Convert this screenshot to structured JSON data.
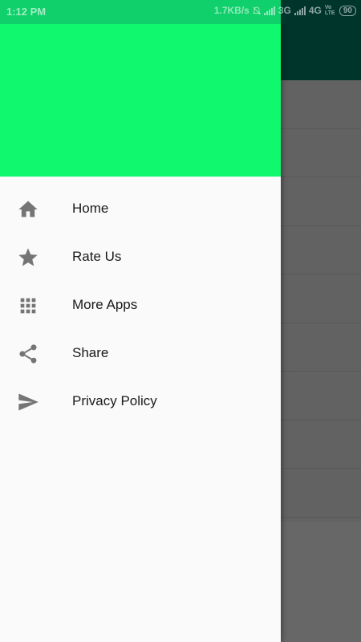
{
  "status_bar": {
    "time": "1:12 PM",
    "speed": "1.7KB/s",
    "network_1": "3G",
    "network_2": "4G",
    "volte": "Vo LTE",
    "battery": "90"
  },
  "drawer": {
    "header_color": "#10f86e",
    "items": [
      {
        "label": "Home",
        "icon": "home-icon"
      },
      {
        "label": "Rate Us",
        "icon": "star-icon"
      },
      {
        "label": "More Apps",
        "icon": "apps-grid-icon"
      },
      {
        "label": "Share",
        "icon": "share-icon"
      },
      {
        "label": "Privacy Policy",
        "icon": "send-icon"
      }
    ]
  }
}
